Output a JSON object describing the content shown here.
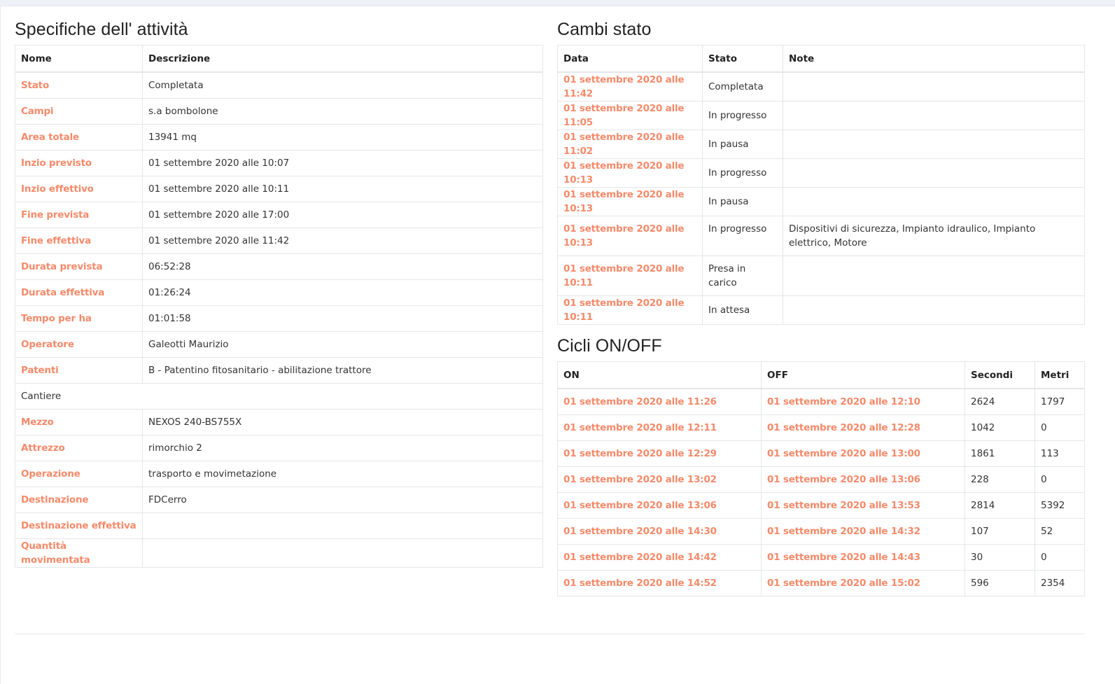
{
  "specs": {
    "title": "Specifiche dell' attività",
    "headers": [
      "Nome",
      "Descrizione"
    ],
    "rows": [
      {
        "label": "Stato",
        "value": "Completata"
      },
      {
        "label": "Campi",
        "value": "s.a bombolone"
      },
      {
        "label": "Area totale",
        "value": "13941 mq"
      },
      {
        "label": "Inzio previsto",
        "value": "01 settembre 2020 alle 10:07"
      },
      {
        "label": "Inzio effettivo",
        "value": "01 settembre 2020 alle 10:11"
      },
      {
        "label": "Fine prevista",
        "value": "01 settembre 2020 alle 17:00"
      },
      {
        "label": "Fine effettiva",
        "value": "01 settembre 2020 alle 11:42"
      },
      {
        "label": "Durata prevista",
        "value": "06:52:28"
      },
      {
        "label": "Durata effettiva",
        "value": "01:26:24"
      },
      {
        "label": "Tempo per ha",
        "value": "01:01:58"
      },
      {
        "label": "Operatore",
        "value": "Galeotti Maurizio"
      },
      {
        "label": "Patenti",
        "value": "B - Patentino fitosanitario - abilitazione trattore"
      }
    ],
    "section_row": "Cantiere",
    "rows2": [
      {
        "label": "Mezzo",
        "value": "NEXOS 240-BS755X"
      },
      {
        "label": "Attrezzo",
        "value": "rimorchio 2"
      },
      {
        "label": "Operazione",
        "value": "trasporto e movimetazione"
      },
      {
        "label": "Destinazione",
        "value": "FDCerro"
      },
      {
        "label": "Destinazione effettiva",
        "value": ""
      },
      {
        "label": "Quantità movimentata",
        "value": ""
      }
    ]
  },
  "status_changes": {
    "title": "Cambi stato",
    "headers": [
      "Data",
      "Stato",
      "Note"
    ],
    "rows": [
      {
        "date": "01 settembre 2020 alle 11:42",
        "state": "Completata",
        "note": ""
      },
      {
        "date": "01 settembre 2020 alle 11:05",
        "state": "In progresso",
        "note": ""
      },
      {
        "date": "01 settembre 2020 alle 11:02",
        "state": "In pausa",
        "note": ""
      },
      {
        "date": "01 settembre 2020 alle 10:13",
        "state": "In progresso",
        "note": ""
      },
      {
        "date": "01 settembre 2020 alle 10:13",
        "state": "In pausa",
        "note": ""
      },
      {
        "date": "01 settembre 2020 alle 10:13",
        "state": "In progresso",
        "note": "Dispositivi di sicurezza, Impianto idraulico, Impianto elettrico, Motore"
      },
      {
        "date": "01 settembre 2020 alle 10:11",
        "state": "Presa in carico",
        "note": ""
      },
      {
        "date": "01 settembre 2020 alle 10:11",
        "state": "In attesa",
        "note": ""
      }
    ]
  },
  "cycles": {
    "title": "Cicli ON/OFF",
    "headers": [
      "ON",
      "OFF",
      "Secondi",
      "Metri"
    ],
    "rows": [
      {
        "on": "01 settembre 2020 alle 11:26",
        "off": "01 settembre 2020 alle 12:10",
        "seconds": "2624",
        "meters": "1797"
      },
      {
        "on": "01 settembre 2020 alle 12:11",
        "off": "01 settembre 2020 alle 12:28",
        "seconds": "1042",
        "meters": "0"
      },
      {
        "on": "01 settembre 2020 alle 12:29",
        "off": "01 settembre 2020 alle 13:00",
        "seconds": "1861",
        "meters": "113"
      },
      {
        "on": "01 settembre 2020 alle 13:02",
        "off": "01 settembre 2020 alle 13:06",
        "seconds": "228",
        "meters": "0"
      },
      {
        "on": "01 settembre 2020 alle 13:06",
        "off": "01 settembre 2020 alle 13:53",
        "seconds": "2814",
        "meters": "5392"
      },
      {
        "on": "01 settembre 2020 alle 14:30",
        "off": "01 settembre 2020 alle 14:32",
        "seconds": "107",
        "meters": "52"
      },
      {
        "on": "01 settembre 2020 alle 14:42",
        "off": "01 settembre 2020 alle 14:43",
        "seconds": "30",
        "meters": "0"
      },
      {
        "on": "01 settembre 2020 alle 14:52",
        "off": "01 settembre 2020 alle 15:02",
        "seconds": "596",
        "meters": "2354"
      }
    ]
  },
  "colors": {
    "accent_label": "#f58a6a",
    "border": "#e4e6e9",
    "topbar": "#eef1f5"
  }
}
